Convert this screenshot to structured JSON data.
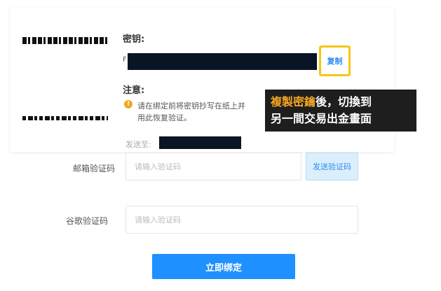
{
  "key_section": {
    "title": "密钥:",
    "key_prefix": "F",
    "copy_label": "复制"
  },
  "note_section": {
    "title": "注意:",
    "warn_icon": "!",
    "line1": "请在绑定前将密钥抄写在纸上并",
    "line2": "用此恢复验证。"
  },
  "annotation": {
    "highlight": "複製密鑰",
    "line1_rest": "後，切換到",
    "line2": "另一間交易出金畫面"
  },
  "send_to": {
    "label": "发送至:"
  },
  "email_code": {
    "label": "邮箱验证码",
    "placeholder": "请输入验证码",
    "send_label": "发送验证码"
  },
  "google_code": {
    "label": "谷歌验证码",
    "placeholder": "请输入验证码"
  },
  "submit": {
    "label": "立即绑定"
  },
  "colors": {
    "primary": "#1e90ff",
    "link": "#2f8cf0",
    "highlight_border": "#f5c518",
    "warning": "#f5a623",
    "annotation_bg": "#1e1e1e"
  }
}
